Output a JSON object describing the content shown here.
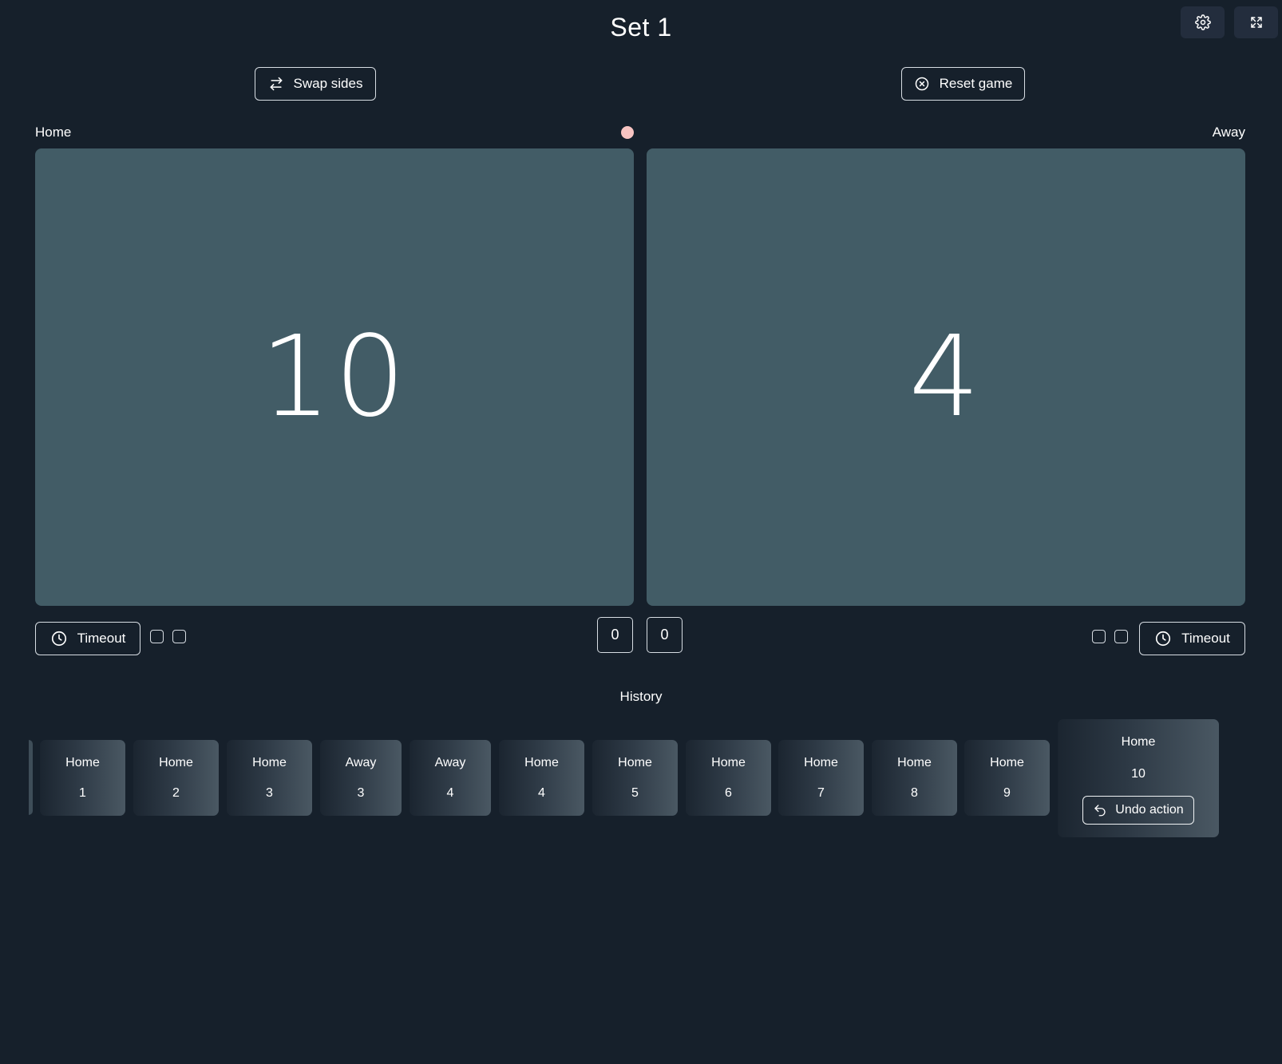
{
  "header": {
    "set_title": "Set 1",
    "settings_icon": "gear-icon",
    "fullscreen_icon": "expand-icon"
  },
  "controls": {
    "swap_label": "Swap sides",
    "swap_icon": "swap-arrows-icon",
    "reset_label": "Reset game",
    "reset_icon": "circle-x-icon"
  },
  "home": {
    "label": "Home",
    "score": "10",
    "timeout_label": "Timeout",
    "timeouts_used": 0,
    "timeouts_total": 2,
    "sets_won": "0"
  },
  "away": {
    "label": "Away",
    "score": "4",
    "timeout_label": "Timeout",
    "timeouts_used": 0,
    "timeouts_total": 2,
    "sets_won": "0"
  },
  "serving": "home",
  "serve_indicator_color": "#f7c4c2",
  "colors": {
    "background": "#16202b",
    "score_panel": "#425c66",
    "icon_button": "#232d3d"
  },
  "history": {
    "title": "History",
    "items": [
      {
        "team": "Home",
        "score": "1"
      },
      {
        "team": "Home",
        "score": "2"
      },
      {
        "team": "Home",
        "score": "3"
      },
      {
        "team": "Away",
        "score": "3"
      },
      {
        "team": "Away",
        "score": "4"
      },
      {
        "team": "Home",
        "score": "4"
      },
      {
        "team": "Home",
        "score": "5"
      },
      {
        "team": "Home",
        "score": "6"
      },
      {
        "team": "Home",
        "score": "7"
      },
      {
        "team": "Home",
        "score": "8"
      },
      {
        "team": "Home",
        "score": "9"
      }
    ],
    "latest": {
      "team": "Home",
      "score": "10",
      "undo_label": "Undo action",
      "undo_icon": "undo-arrow-icon"
    }
  }
}
